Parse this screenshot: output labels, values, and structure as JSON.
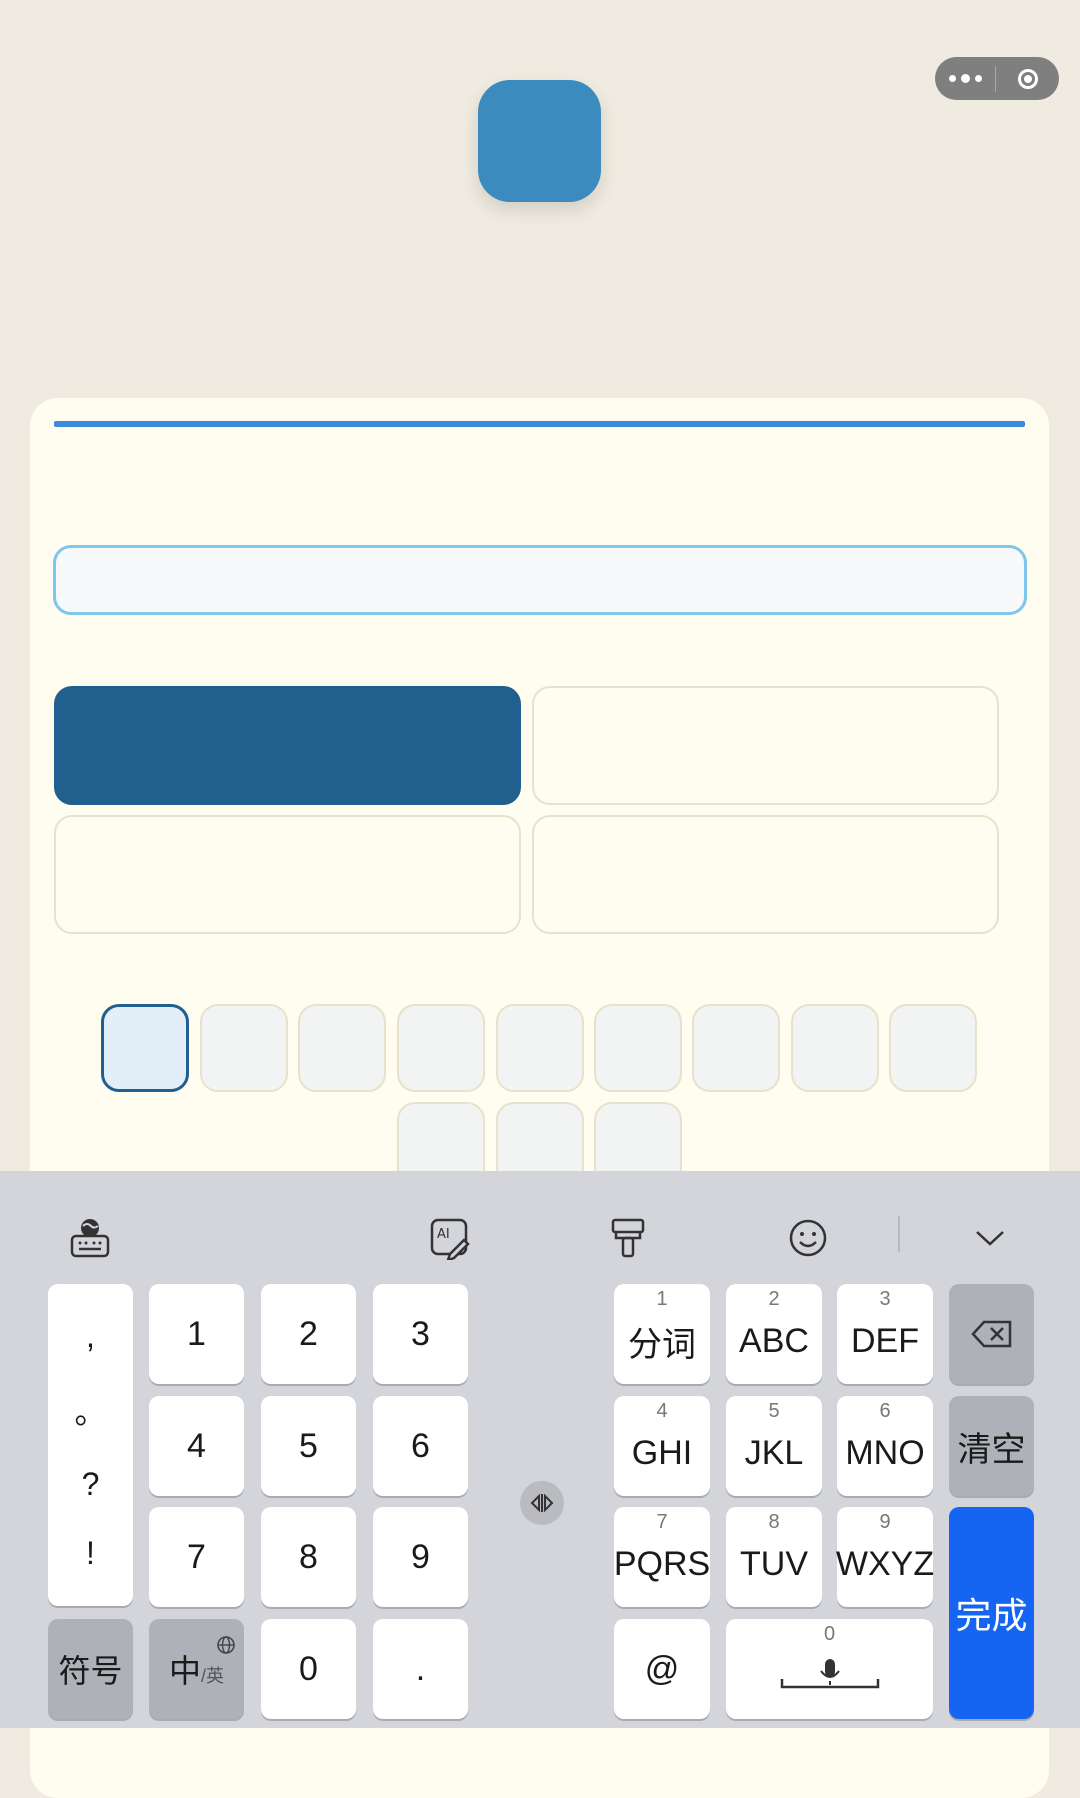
{
  "keyboard": {
    "punctuation": [
      ",",
      "。",
      "?",
      "!"
    ],
    "numpad": [
      "1",
      "2",
      "3",
      "4",
      "5",
      "6",
      "7",
      "8",
      "9"
    ],
    "zero": "0",
    "dot": ".",
    "symbols_label": "符号",
    "lang_label_main": "中",
    "lang_label_sub": "/英",
    "t9": [
      {
        "num": "1",
        "label": "分词"
      },
      {
        "num": "2",
        "label": "ABC"
      },
      {
        "num": "3",
        "label": "DEF"
      },
      {
        "num": "4",
        "label": "GHI"
      },
      {
        "num": "5",
        "label": "JKL"
      },
      {
        "num": "6",
        "label": "MNO"
      },
      {
        "num": "7",
        "label": "PQRS"
      },
      {
        "num": "8",
        "label": "TUV"
      },
      {
        "num": "9",
        "label": "WXYZ"
      }
    ],
    "at": "@",
    "space_num": "0",
    "clear_label": "清空",
    "done_label": "完成"
  },
  "colors": {
    "background": "#efebe0",
    "card": "#fffcf0",
    "accent_line": "#3b89d8",
    "selected_option": "#215f8e",
    "logo": "#3b8bbf",
    "done_key": "#1565f2"
  }
}
